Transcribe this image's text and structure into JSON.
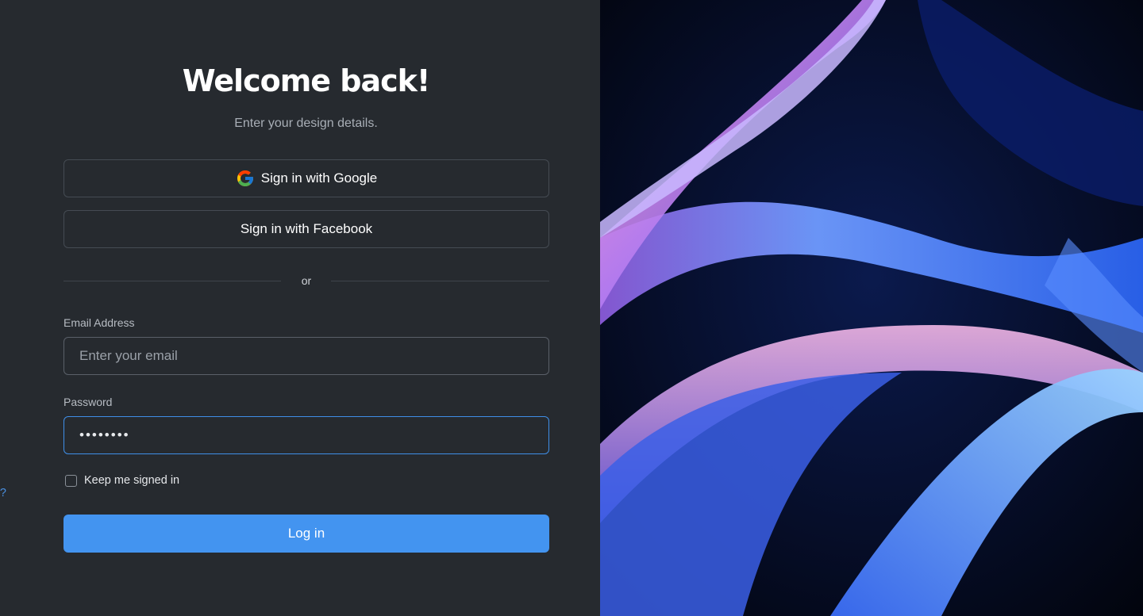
{
  "header": {
    "title": "Welcome back!",
    "subtitle": "Enter your design details."
  },
  "oauth": {
    "google_label": "Sign in with Google",
    "google_icon": "google-g-icon",
    "facebook_label": "Sign in with Facebook"
  },
  "divider": {
    "text": "or"
  },
  "form": {
    "email_label": "Email Address",
    "email_placeholder": "Enter your email",
    "email_value": "",
    "password_label": "Password",
    "password_value": "••••••••",
    "remember_label": "Keep me signed in",
    "remember_checked": false,
    "forgot_label": "Forget password?",
    "login_label": "Log in"
  },
  "colors": {
    "panel_bg": "#262a2f",
    "accent": "#4394f0",
    "link": "#4a90e2",
    "focus_border": "#3f8fe8"
  }
}
